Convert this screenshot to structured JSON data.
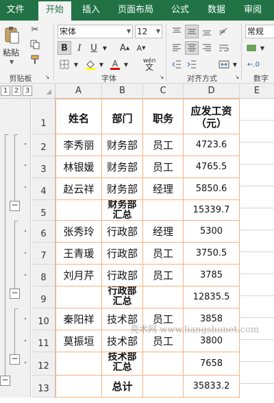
{
  "tabs": [
    "文件",
    "开始",
    "插入",
    "页面布局",
    "公式",
    "数据",
    "审阅"
  ],
  "ribbon": {
    "paste": "粘贴",
    "font_name": "宋体",
    "font_size": "12",
    "number_format": "常规",
    "groups": {
      "clipboard": "剪贴板",
      "font": "字体",
      "alignment": "对齐方式",
      "number": "数字"
    },
    "phonetic": "wén"
  },
  "columns": [
    "A",
    "B",
    "C",
    "D",
    "E"
  ],
  "outline_levels": [
    "1",
    "2",
    "3"
  ],
  "header": {
    "name": "姓名",
    "dept": "部门",
    "role": "职务",
    "salary": "应发工资（元）"
  },
  "rows": [
    {
      "num": "1"
    },
    {
      "num": "2",
      "name": "李秀丽",
      "dept": "财务部",
      "role": "员工",
      "salary": "4723.6"
    },
    {
      "num": "3",
      "name": "林银媛",
      "dept": "财务部",
      "role": "员工",
      "salary": "4765.5"
    },
    {
      "num": "4",
      "name": "赵云祥",
      "dept": "财务部",
      "role": "经理",
      "salary": "5850.6"
    },
    {
      "num": "5",
      "name": "",
      "dept": "财务部 汇总",
      "role": "",
      "salary": "15339.7"
    },
    {
      "num": "6",
      "name": "张秀玲",
      "dept": "行政部",
      "role": "经理",
      "salary": "5300"
    },
    {
      "num": "7",
      "name": "王青瑗",
      "dept": "行政部",
      "role": "员工",
      "salary": "3750.5"
    },
    {
      "num": "8",
      "name": "刘月芹",
      "dept": "行政部",
      "role": "员工",
      "salary": "3785"
    },
    {
      "num": "9",
      "name": "",
      "dept": "行政部 汇总",
      "role": "",
      "salary": "12835.5"
    },
    {
      "num": "10",
      "name": "秦阳祥",
      "dept": "技术部",
      "role": "员工",
      "salary": "3858"
    },
    {
      "num": "11",
      "name": "莫振垣",
      "dept": "技术部",
      "role": "员工",
      "salary": "3800"
    },
    {
      "num": "12",
      "name": "",
      "dept": "技术部 汇总",
      "role": "",
      "salary": "7658"
    },
    {
      "num": "13",
      "name": "",
      "dept": "总计",
      "role": "",
      "salary": "35833.2"
    }
  ],
  "watermark": "亮术网 www.liangshunet.com"
}
